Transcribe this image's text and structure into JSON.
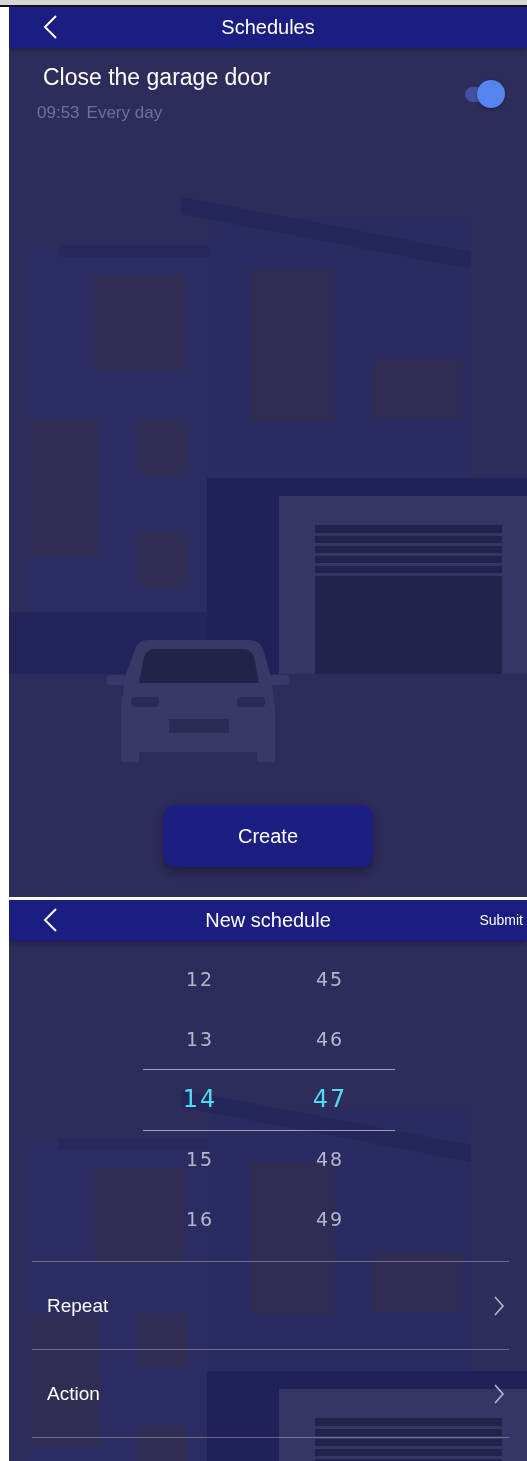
{
  "schedules_screen": {
    "title": "Schedules",
    "schedules": [
      {
        "name": "Close the garage door",
        "time": "09:53",
        "repeat": "Every day",
        "on": true
      }
    ],
    "create_button": "Create"
  },
  "new_schedule_screen": {
    "title": "New schedule",
    "submit": "Submit",
    "hours": [
      {
        "value": "12",
        "selected": false
      },
      {
        "value": "13",
        "selected": false
      },
      {
        "value": "14",
        "selected": true
      },
      {
        "value": "15",
        "selected": false
      },
      {
        "value": "16",
        "selected": false
      }
    ],
    "minutes": [
      {
        "value": "45",
        "selected": false
      },
      {
        "value": "46",
        "selected": false
      },
      {
        "value": "47",
        "selected": true
      },
      {
        "value": "48",
        "selected": false
      },
      {
        "value": "49",
        "selected": false
      }
    ],
    "rows": [
      {
        "label": "Repeat"
      },
      {
        "label": "Action"
      }
    ]
  }
}
